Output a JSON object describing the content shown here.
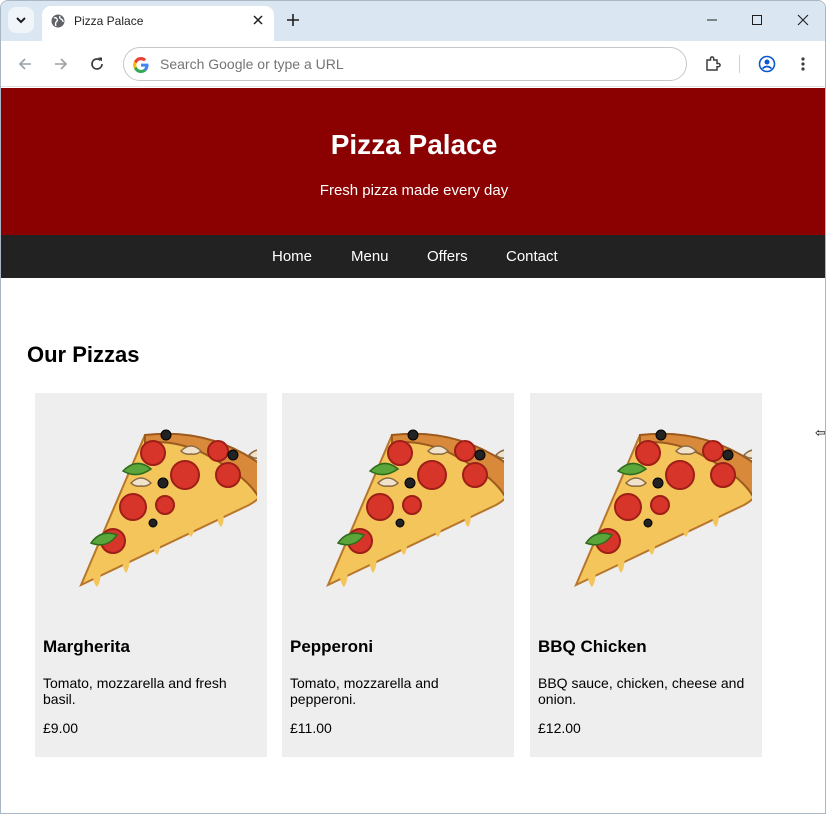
{
  "browser": {
    "tab_title": "Pizza Palace",
    "omnibox_placeholder": "Search Google or type a URL"
  },
  "site": {
    "title": "Pizza Palace",
    "tagline": "Fresh pizza made every day",
    "nav": [
      "Home",
      "Menu",
      "Offers",
      "Contact"
    ],
    "section_title": "Our Pizzas",
    "pizzas": [
      {
        "name": "Margherita",
        "description": "Tomato, mozzarella and fresh basil.",
        "price": "£9.00"
      },
      {
        "name": "Pepperoni",
        "description": "Tomato, mozzarella and pepperoni.",
        "price": "£11.00"
      },
      {
        "name": "BBQ Chicken",
        "description": "BBQ sauce, chicken, cheese and onion.",
        "price": "£12.00"
      }
    ]
  },
  "colors": {
    "hero_bg": "#8b0000",
    "nav_bg": "#222222",
    "card_bg": "#efeeef",
    "tabstrip_bg": "#dae7f3"
  }
}
